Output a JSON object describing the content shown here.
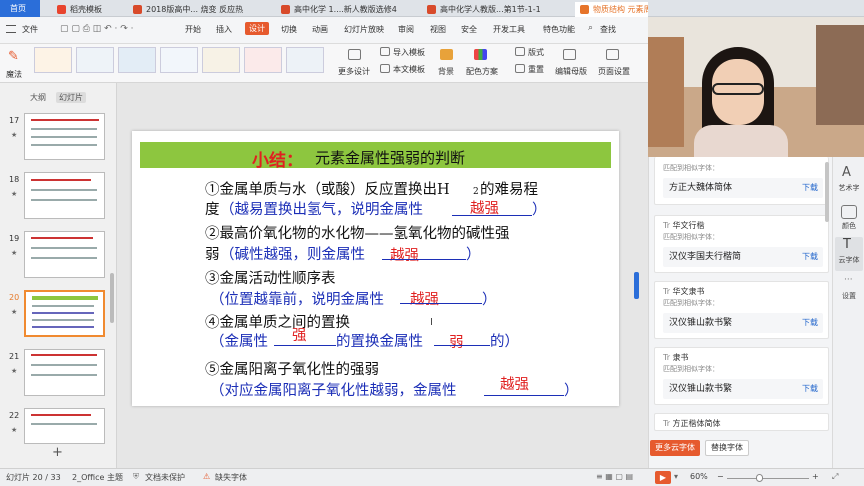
{
  "tabs": [
    {
      "label": "首页",
      "color": "#ffffff"
    },
    {
      "label": "稻壳模板",
      "color": "#e8442e"
    },
    {
      "label": "2018版高中... 烧变  反应热",
      "color": "#d84a2a"
    },
    {
      "label": "高中化学 1....新人教版选修4",
      "color": "#d84a2a"
    },
    {
      "label": "高中化学人教版...第1节-1-1",
      "color": "#d84a2a"
    },
    {
      "label": "物质结构  元素周期",
      "color": "#e6742a"
    }
  ],
  "menu": {
    "file": "文件",
    "items": [
      "开始",
      "插入",
      "设计",
      "切换",
      "动画",
      "幻灯片放映",
      "审阅",
      "视图",
      "安全",
      "开发工具",
      "特色功能"
    ],
    "active": "设计",
    "search": "查找"
  },
  "ribbon": {
    "magic": "魔法",
    "more_design": "更多设计",
    "import_template": "导入模板",
    "this_template": "本文模板",
    "background": "背景",
    "color_scheme": "配色方案",
    "layout": "版式",
    "reset": "重置",
    "edit_master": "编辑母版",
    "page_setup": "页面设置"
  },
  "left_panel": {
    "tab_outline": "大纲",
    "tab_slides": "幻灯片",
    "add": "+",
    "slides": [
      {
        "num": "17"
      },
      {
        "num": "18"
      },
      {
        "num": "19"
      },
      {
        "num": "20"
      },
      {
        "num": "21"
      },
      {
        "num": "22"
      }
    ]
  },
  "slide": {
    "title_red": "小结：",
    "title_black": "元素金属性强弱的判断",
    "l1a": "①金属单质与水（或酸）反应置换出H",
    "l1sub": "2",
    "l1b": "的难易程",
    "l2a": "度",
    "l2b": "（越易置换出氢气，说明金属性",
    "l2ans": "越强",
    "l2c": "）",
    "l3": "②最高价氧化物的水化物——氢氧化物的碱性强",
    "l4a": "弱",
    "l4b": "（碱性越强，则金属性",
    "l4ans": "越强",
    "l4c": "）",
    "l5": "③金属活动性顺序表",
    "l6a": "（位置越靠前，说明金属性",
    "l6ans": "越强",
    "l6c": "）",
    "l7": "④金属单质之间的置换",
    "l8ans1": "强",
    "l8a": "（金属性",
    "l8b": "的置换金属性",
    "l8ans2": "弱",
    "l8c": "的）",
    "l9": "⑤金属阳离子氧化性的强弱",
    "l10ans": "越强",
    "l10a": "（对应金属阳离子氧化性越弱，金属性",
    "l10c": "）"
  },
  "font_panel": {
    "cards": [
      {
        "name": "",
        "match": "匹配到相似字体：",
        "sample": "方正大魏体简体",
        "dl": "下载"
      },
      {
        "name": "华文行楷",
        "match": "匹配到相似字体：",
        "sample": "汉仪李国夫行楷简",
        "dl": "下载"
      },
      {
        "name": "华文隶书",
        "match": "匹配到相似字体：",
        "sample": "汉仪锥山款书繁",
        "dl": "下载"
      },
      {
        "name": "隶书",
        "match": "匹配到相似字体：",
        "sample": "汉仪锥山款书繁",
        "dl": "下载"
      },
      {
        "name": "方正楷体简体",
        "match": "",
        "sample": "",
        "dl": ""
      }
    ],
    "more_btn": "更多云字体",
    "replace_btn": "替换字体"
  },
  "sidebar": {
    "art": "艺术字",
    "color": "颜色",
    "cloud": "云字体",
    "settings": "设置"
  },
  "status": {
    "slide_count": "幻灯片 20 / 33",
    "theme": "2_Office 主题",
    "protect": "文档未保护",
    "font_missing": "缺失字体",
    "zoom": "60%"
  }
}
